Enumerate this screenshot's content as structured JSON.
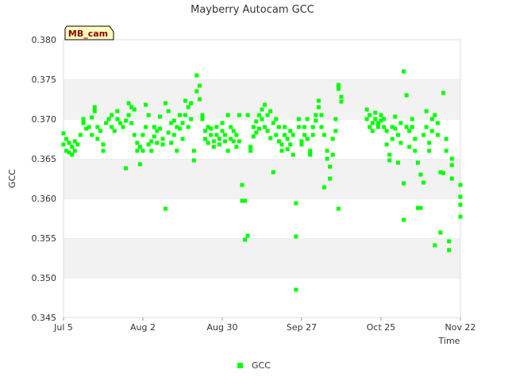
{
  "chart_data": {
    "type": "scatter",
    "title": "Mayberry Autocam GCC",
    "xlabel": "Time",
    "ylabel": "GCC",
    "xlim": [
      "2024-07-05",
      "2024-11-22"
    ],
    "ylim": [
      0.345,
      0.38
    ],
    "x_ticks": [
      "Jul 5",
      "Aug 2",
      "Aug 30",
      "Sep 27",
      "Oct 25",
      "Nov 22"
    ],
    "y_ticks": [
      "0.345",
      "0.350",
      "0.355",
      "0.360",
      "0.365",
      "0.370",
      "0.375",
      "0.380"
    ],
    "grid": "horizontal bands",
    "legend_position": "bottom-center",
    "site_tag": "MB_cam",
    "series": [
      {
        "name": "GCC",
        "color": "#00ff00",
        "points": [
          [
            "2024-07-05",
            0.3682
          ],
          [
            "2024-07-05",
            0.3668
          ],
          [
            "2024-07-06",
            0.366
          ],
          [
            "2024-07-06",
            0.3675
          ],
          [
            "2024-07-07",
            0.367
          ],
          [
            "2024-07-07",
            0.3658
          ],
          [
            "2024-07-08",
            0.3665
          ],
          [
            "2024-07-08",
            0.3655
          ],
          [
            "2024-07-09",
            0.3672
          ],
          [
            "2024-07-09",
            0.366
          ],
          [
            "2024-07-10",
            0.3668
          ],
          [
            "2024-07-11",
            0.368
          ],
          [
            "2024-07-12",
            0.3695
          ],
          [
            "2024-07-12",
            0.37
          ],
          [
            "2024-07-13",
            0.3688
          ],
          [
            "2024-07-14",
            0.369
          ],
          [
            "2024-07-15",
            0.3702
          ],
          [
            "2024-07-15",
            0.368
          ],
          [
            "2024-07-16",
            0.371
          ],
          [
            "2024-07-16",
            0.3715
          ],
          [
            "2024-07-17",
            0.369
          ],
          [
            "2024-07-17",
            0.3675
          ],
          [
            "2024-07-18",
            0.3685
          ],
          [
            "2024-07-19",
            0.366
          ],
          [
            "2024-07-19",
            0.3668
          ],
          [
            "2024-07-20",
            0.3695
          ],
          [
            "2024-07-21",
            0.37
          ],
          [
            "2024-07-22",
            0.3705
          ],
          [
            "2024-07-22",
            0.369
          ],
          [
            "2024-07-23",
            0.3685
          ],
          [
            "2024-07-24",
            0.371
          ],
          [
            "2024-07-24",
            0.37
          ],
          [
            "2024-07-25",
            0.3695
          ],
          [
            "2024-07-26",
            0.369
          ],
          [
            "2024-07-27",
            0.3698
          ],
          [
            "2024-07-27",
            0.3638
          ],
          [
            "2024-07-28",
            0.372
          ],
          [
            "2024-07-28",
            0.3705
          ],
          [
            "2024-07-29",
            0.3715
          ],
          [
            "2024-07-29",
            0.3695
          ],
          [
            "2024-07-30",
            0.3712
          ],
          [
            "2024-07-30",
            0.368
          ],
          [
            "2024-07-31",
            0.367
          ],
          [
            "2024-07-31",
            0.366
          ],
          [
            "2024-08-01",
            0.3643
          ],
          [
            "2024-08-01",
            0.3665
          ],
          [
            "2024-08-02",
            0.368
          ],
          [
            "2024-08-02",
            0.366
          ],
          [
            "2024-08-03",
            0.369
          ],
          [
            "2024-08-03",
            0.3718
          ],
          [
            "2024-08-04",
            0.3668
          ],
          [
            "2024-08-04",
            0.3705
          ],
          [
            "2024-08-05",
            0.3672
          ],
          [
            "2024-08-05",
            0.366
          ],
          [
            "2024-08-06",
            0.369
          ],
          [
            "2024-08-06",
            0.3678
          ],
          [
            "2024-08-07",
            0.3685
          ],
          [
            "2024-08-07",
            0.367
          ],
          [
            "2024-08-08",
            0.3703
          ],
          [
            "2024-08-08",
            0.3688
          ],
          [
            "2024-08-09",
            0.3675
          ],
          [
            "2024-08-09",
            0.3668
          ],
          [
            "2024-08-10",
            0.372
          ],
          [
            "2024-08-10",
            0.3587
          ],
          [
            "2024-08-11",
            0.371
          ],
          [
            "2024-08-11",
            0.3683
          ],
          [
            "2024-08-12",
            0.3695
          ],
          [
            "2024-08-12",
            0.367
          ],
          [
            "2024-08-13",
            0.368
          ],
          [
            "2024-08-13",
            0.3698
          ],
          [
            "2024-08-14",
            0.369
          ],
          [
            "2024-08-14",
            0.366
          ],
          [
            "2024-08-15",
            0.3705
          ],
          [
            "2024-08-15",
            0.3688
          ],
          [
            "2024-08-16",
            0.3695
          ],
          [
            "2024-08-16",
            0.3675
          ],
          [
            "2024-08-17",
            0.3723
          ],
          [
            "2024-08-17",
            0.3705
          ],
          [
            "2024-08-18",
            0.3715
          ],
          [
            "2024-08-18",
            0.369
          ],
          [
            "2024-08-19",
            0.372
          ],
          [
            "2024-08-19",
            0.37
          ],
          [
            "2024-08-20",
            0.366
          ],
          [
            "2024-08-20",
            0.3648
          ],
          [
            "2024-08-21",
            0.3755
          ],
          [
            "2024-08-21",
            0.3735
          ],
          [
            "2024-08-22",
            0.3742
          ],
          [
            "2024-08-22",
            0.3725
          ],
          [
            "2024-08-23",
            0.37
          ],
          [
            "2024-08-23",
            0.3705
          ],
          [
            "2024-08-24",
            0.3685
          ],
          [
            "2024-08-24",
            0.3675
          ],
          [
            "2024-08-25",
            0.369
          ],
          [
            "2024-08-25",
            0.367
          ],
          [
            "2024-08-26",
            0.368
          ],
          [
            "2024-08-26",
            0.3688
          ],
          [
            "2024-08-27",
            0.3672
          ],
          [
            "2024-08-27",
            0.3665
          ],
          [
            "2024-08-28",
            0.369
          ],
          [
            "2024-08-28",
            0.368
          ],
          [
            "2024-08-29",
            0.3675
          ],
          [
            "2024-08-29",
            0.3668
          ],
          [
            "2024-08-30",
            0.3685
          ],
          [
            "2024-08-30",
            0.3695
          ],
          [
            "2024-08-31",
            0.3672
          ],
          [
            "2024-08-31",
            0.368
          ],
          [
            "2024-09-01",
            0.366
          ],
          [
            "2024-09-01",
            0.3705
          ],
          [
            "2024-09-02",
            0.3675
          ],
          [
            "2024-09-02",
            0.369
          ],
          [
            "2024-09-03",
            0.3685
          ],
          [
            "2024-09-03",
            0.3672
          ],
          [
            "2024-09-04",
            0.3665
          ],
          [
            "2024-09-04",
            0.368
          ],
          [
            "2024-09-05",
            0.3705
          ],
          [
            "2024-09-05",
            0.3672
          ],
          [
            "2024-09-06",
            0.3617
          ],
          [
            "2024-09-06",
            0.3597
          ],
          [
            "2024-09-07",
            0.3548
          ],
          [
            "2024-09-07",
            0.3597
          ],
          [
            "2024-09-08",
            0.3553
          ],
          [
            "2024-09-08",
            0.3705
          ],
          [
            "2024-09-09",
            0.3665
          ],
          [
            "2024-09-09",
            0.366
          ],
          [
            "2024-09-10",
            0.369
          ],
          [
            "2024-09-10",
            0.3678
          ],
          [
            "2024-09-11",
            0.3697
          ],
          [
            "2024-09-11",
            0.3683
          ],
          [
            "2024-09-12",
            0.3705
          ],
          [
            "2024-09-12",
            0.3688
          ],
          [
            "2024-09-13",
            0.3712
          ],
          [
            "2024-09-13",
            0.37
          ],
          [
            "2024-09-14",
            0.3718
          ],
          [
            "2024-09-14",
            0.369
          ],
          [
            "2024-09-15",
            0.3705
          ],
          [
            "2024-09-15",
            0.3685
          ],
          [
            "2024-09-16",
            0.371
          ],
          [
            "2024-09-16",
            0.3676
          ],
          [
            "2024-09-17",
            0.3633
          ],
          [
            "2024-09-17",
            0.3695
          ],
          [
            "2024-09-18",
            0.37
          ],
          [
            "2024-09-18",
            0.368
          ],
          [
            "2024-09-19",
            0.369
          ],
          [
            "2024-09-19",
            0.3672
          ],
          [
            "2024-09-20",
            0.3668
          ],
          [
            "2024-09-20",
            0.366
          ],
          [
            "2024-09-21",
            0.368
          ],
          [
            "2024-09-21",
            0.369
          ],
          [
            "2024-09-22",
            0.3662
          ],
          [
            "2024-09-22",
            0.3675
          ],
          [
            "2024-09-23",
            0.3685
          ],
          [
            "2024-09-23",
            0.3668
          ],
          [
            "2024-09-24",
            0.368
          ],
          [
            "2024-09-24",
            0.3655
          ],
          [
            "2024-09-25",
            0.3594
          ],
          [
            "2024-09-25",
            0.3552
          ],
          [
            "2024-09-25",
            0.3485
          ],
          [
            "2024-09-26",
            0.37
          ],
          [
            "2024-09-26",
            0.369
          ],
          [
            "2024-09-27",
            0.3672
          ],
          [
            "2024-09-27",
            0.3668
          ],
          [
            "2024-09-28",
            0.369
          ],
          [
            "2024-09-28",
            0.368
          ],
          [
            "2024-09-29",
            0.37
          ],
          [
            "2024-09-29",
            0.3675
          ],
          [
            "2024-09-30",
            0.366
          ],
          [
            "2024-09-30",
            0.3655
          ],
          [
            "2024-10-01",
            0.369
          ],
          [
            "2024-10-01",
            0.368
          ],
          [
            "2024-10-02",
            0.3705
          ],
          [
            "2024-10-02",
            0.3698
          ],
          [
            "2024-10-03",
            0.3715
          ],
          [
            "2024-10-03",
            0.3723
          ],
          [
            "2024-10-04",
            0.3705
          ],
          [
            "2024-10-04",
            0.369
          ],
          [
            "2024-10-05",
            0.3614
          ],
          [
            "2024-10-05",
            0.368
          ],
          [
            "2024-10-06",
            0.366
          ],
          [
            "2024-10-06",
            0.365
          ],
          [
            "2024-10-07",
            0.364
          ],
          [
            "2024-10-07",
            0.3625
          ],
          [
            "2024-10-08",
            0.3675
          ],
          [
            "2024-10-08",
            0.3655
          ],
          [
            "2024-10-09",
            0.3685
          ],
          [
            "2024-10-09",
            0.37
          ],
          [
            "2024-10-10",
            0.3743
          ],
          [
            "2024-10-10",
            0.3738
          ],
          [
            "2024-10-10",
            0.3587
          ],
          [
            "2024-10-11",
            0.3728
          ],
          [
            "2024-10-11",
            0.3722
          ],
          [
            "2024-10-20",
            0.3712
          ],
          [
            "2024-10-20",
            0.37
          ],
          [
            "2024-10-21",
            0.369
          ],
          [
            "2024-10-21",
            0.3705
          ],
          [
            "2024-10-22",
            0.3695
          ],
          [
            "2024-10-22",
            0.3685
          ],
          [
            "2024-10-23",
            0.3708
          ],
          [
            "2024-10-23",
            0.37
          ],
          [
            "2024-10-24",
            0.3695
          ],
          [
            "2024-10-24",
            0.369
          ],
          [
            "2024-10-25",
            0.3705
          ],
          [
            "2024-10-25",
            0.3698
          ],
          [
            "2024-10-26",
            0.369
          ],
          [
            "2024-10-26",
            0.37
          ],
          [
            "2024-10-27",
            0.3685
          ],
          [
            "2024-10-27",
            0.3668
          ],
          [
            "2024-10-28",
            0.3648
          ],
          [
            "2024-10-28",
            0.3655
          ],
          [
            "2024-10-29",
            0.3675
          ],
          [
            "2024-10-29",
            0.369
          ],
          [
            "2024-10-30",
            0.3703
          ],
          [
            "2024-10-30",
            0.3688
          ],
          [
            "2024-10-31",
            0.3645
          ],
          [
            "2024-10-31",
            0.368
          ],
          [
            "2024-11-01",
            0.3695
          ],
          [
            "2024-11-01",
            0.367
          ],
          [
            "2024-11-02",
            0.376
          ],
          [
            "2024-11-02",
            0.3573
          ],
          [
            "2024-11-02",
            0.3619
          ],
          [
            "2024-11-03",
            0.373
          ],
          [
            "2024-11-03",
            0.369
          ],
          [
            "2024-11-04",
            0.3685
          ],
          [
            "2024-11-04",
            0.3665
          ],
          [
            "2024-11-05",
            0.37
          ],
          [
            "2024-11-05",
            0.369
          ],
          [
            "2024-11-06",
            0.3675
          ],
          [
            "2024-11-06",
            0.366
          ],
          [
            "2024-11-07",
            0.3588
          ],
          [
            "2024-11-07",
            0.3645
          ],
          [
            "2024-11-08",
            0.3588
          ],
          [
            "2024-11-08",
            0.363
          ],
          [
            "2024-11-09",
            0.362
          ],
          [
            "2024-11-09",
            0.368
          ],
          [
            "2024-11-10",
            0.371
          ],
          [
            "2024-11-10",
            0.369
          ],
          [
            "2024-11-11",
            0.367
          ],
          [
            "2024-11-11",
            0.366
          ],
          [
            "2024-11-12",
            0.37
          ],
          [
            "2024-11-12",
            0.3685
          ],
          [
            "2024-11-13",
            0.3541
          ],
          [
            "2024-11-13",
            0.3705
          ],
          [
            "2024-11-14",
            0.3695
          ],
          [
            "2024-11-14",
            0.368
          ],
          [
            "2024-11-15",
            0.3557
          ],
          [
            "2024-11-15",
            0.3633
          ],
          [
            "2024-11-16",
            0.3733
          ],
          [
            "2024-11-16",
            0.3632
          ],
          [
            "2024-11-17",
            0.3675
          ],
          [
            "2024-11-17",
            0.366
          ],
          [
            "2024-11-18",
            0.3546
          ],
          [
            "2024-11-18",
            0.3535
          ],
          [
            "2024-11-19",
            0.365
          ],
          [
            "2024-11-19",
            0.3642
          ],
          [
            "2024-11-19",
            0.3625
          ],
          [
            "2024-11-22",
            0.3617
          ],
          [
            "2024-11-22",
            0.3602
          ],
          [
            "2024-11-22",
            0.3592
          ],
          [
            "2024-11-22",
            0.3577
          ]
        ]
      }
    ]
  }
}
